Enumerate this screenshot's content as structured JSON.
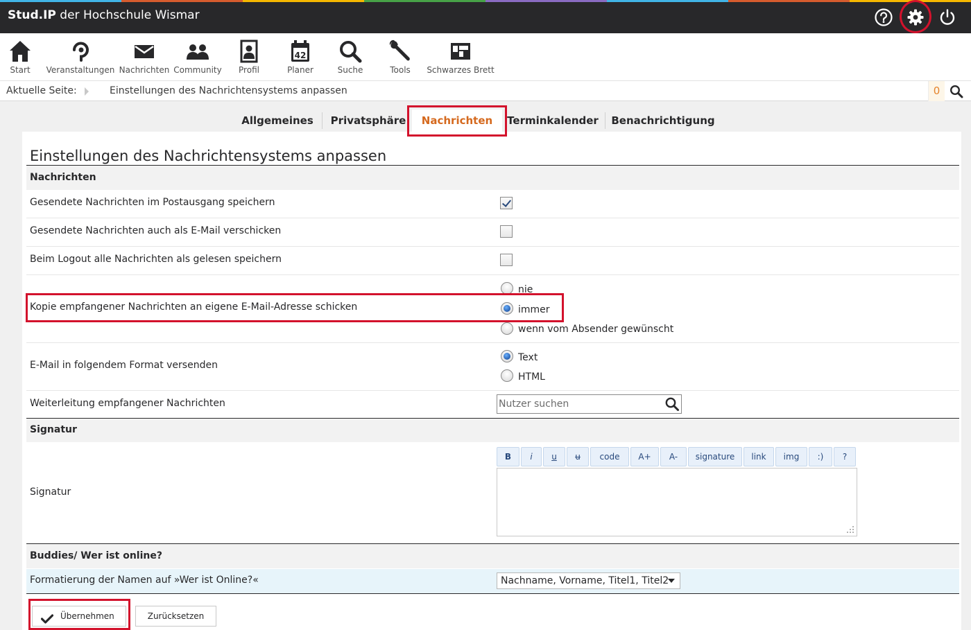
{
  "colors": {
    "topbar": "#28282a",
    "highlight_red": "#d3122c",
    "active_tab": "#d5691e",
    "strip": [
      "#41b4e6",
      "#d65c2e",
      "#f5b700",
      "#47a247",
      "#8a6bc1",
      "#41b4e6",
      "#d65c2e",
      "#f5b700"
    ]
  },
  "header": {
    "brand_bold": "Stud.IP",
    "brand_rest": " der Hochschule Wismar",
    "icons": [
      "help-icon",
      "settings-icon",
      "logout-icon"
    ]
  },
  "nav": {
    "items": [
      {
        "label": "Start",
        "icon": "home-icon"
      },
      {
        "label": "Veranstaltungen",
        "icon": "seminar-icon"
      },
      {
        "label": "Nachrichten",
        "icon": "mail-icon"
      },
      {
        "label": "Community",
        "icon": "community-icon"
      },
      {
        "label": "Profil",
        "icon": "profile-icon"
      },
      {
        "label": "Planer",
        "icon": "calendar-icon"
      },
      {
        "label": "Suche",
        "icon": "search-icon"
      },
      {
        "label": "Tools",
        "icon": "wrench-icon"
      },
      {
        "label": "Schwarzes Brett",
        "icon": "board-icon"
      }
    ]
  },
  "breadcrumb": {
    "label": "Aktuelle Seite:",
    "page": "Einstellungen des Nachrichtensystems anpassen",
    "count": "0"
  },
  "tabs": [
    {
      "label": "Allgemeines"
    },
    {
      "label": "Privatsphäre"
    },
    {
      "label": "Nachrichten",
      "active": true
    },
    {
      "label": "Terminkalender"
    },
    {
      "label": "Benachrichtigung"
    }
  ],
  "page": {
    "title": "Einstellungen des Nachrichtensystems anpassen"
  },
  "sections": {
    "messages": {
      "title": "Nachrichten",
      "save_outbox": {
        "label": "Gesendete Nachrichten im Postausgang speichern",
        "checked": true
      },
      "send_email": {
        "label": "Gesendete Nachrichten auch als E-Mail verschicken",
        "checked": false
      },
      "logout_read": {
        "label": "Beim Logout alle Nachrichten als gelesen speichern",
        "checked": false
      },
      "copy": {
        "label": "Kopie empfangener Nachrichten an eigene E-Mail-Adresse schicken",
        "options": [
          "nie",
          "immer",
          "wenn vom Absender gewünscht"
        ],
        "selected": "immer"
      },
      "format": {
        "label": "E-Mail in folgendem Format versenden",
        "options": [
          "Text",
          "HTML"
        ],
        "selected": "Text"
      },
      "forward": {
        "label": "Weiterleitung empfangener Nachrichten",
        "placeholder": "Nutzer suchen",
        "value": ""
      }
    },
    "signature": {
      "title": "Signatur",
      "label": "Signatur",
      "toolbar": [
        "B",
        "i",
        "u",
        "u",
        "code",
        "A+",
        "A-",
        "signature",
        "link",
        "img",
        ":)",
        "?"
      ],
      "value": ""
    },
    "buddies": {
      "title": "Buddies/ Wer ist online?",
      "format_label": "Formatierung der Namen auf »Wer ist Online?«",
      "format_selected": "Nachname, Vorname, Titel1, Titel2"
    }
  },
  "buttons": {
    "apply": "Übernehmen",
    "reset": "Zurücksetzen"
  }
}
